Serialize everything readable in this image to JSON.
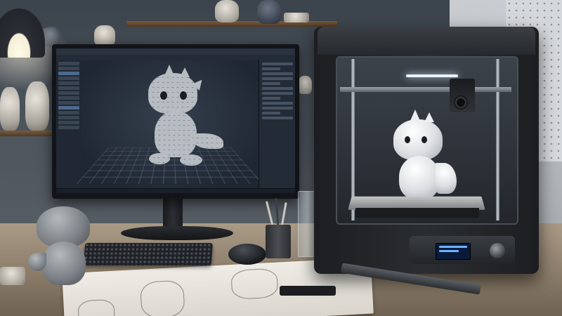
{
  "scene": {
    "description_free": true,
    "objects": {
      "monitor": {
        "software_window": "3d-modeling-app",
        "model": "dragon-wireframe"
      },
      "printer": {
        "model_on_bed": "white-dragon-print"
      },
      "desk_items": [
        "keyboard",
        "mouse",
        "pen-cup",
        "glass",
        "caliper",
        "sketch-sheet",
        "grey-dragon-figurine"
      ]
    }
  },
  "colors": {
    "screen_bg": "#1c2430",
    "printer_body": "#2a2d31",
    "lcd_text": "#6fb1ff",
    "led_light": "#eaf3ff",
    "desk": "#a99a86"
  },
  "icons": {
    "lamp": "desk-lamp-icon",
    "knob": "control-knob-icon"
  }
}
